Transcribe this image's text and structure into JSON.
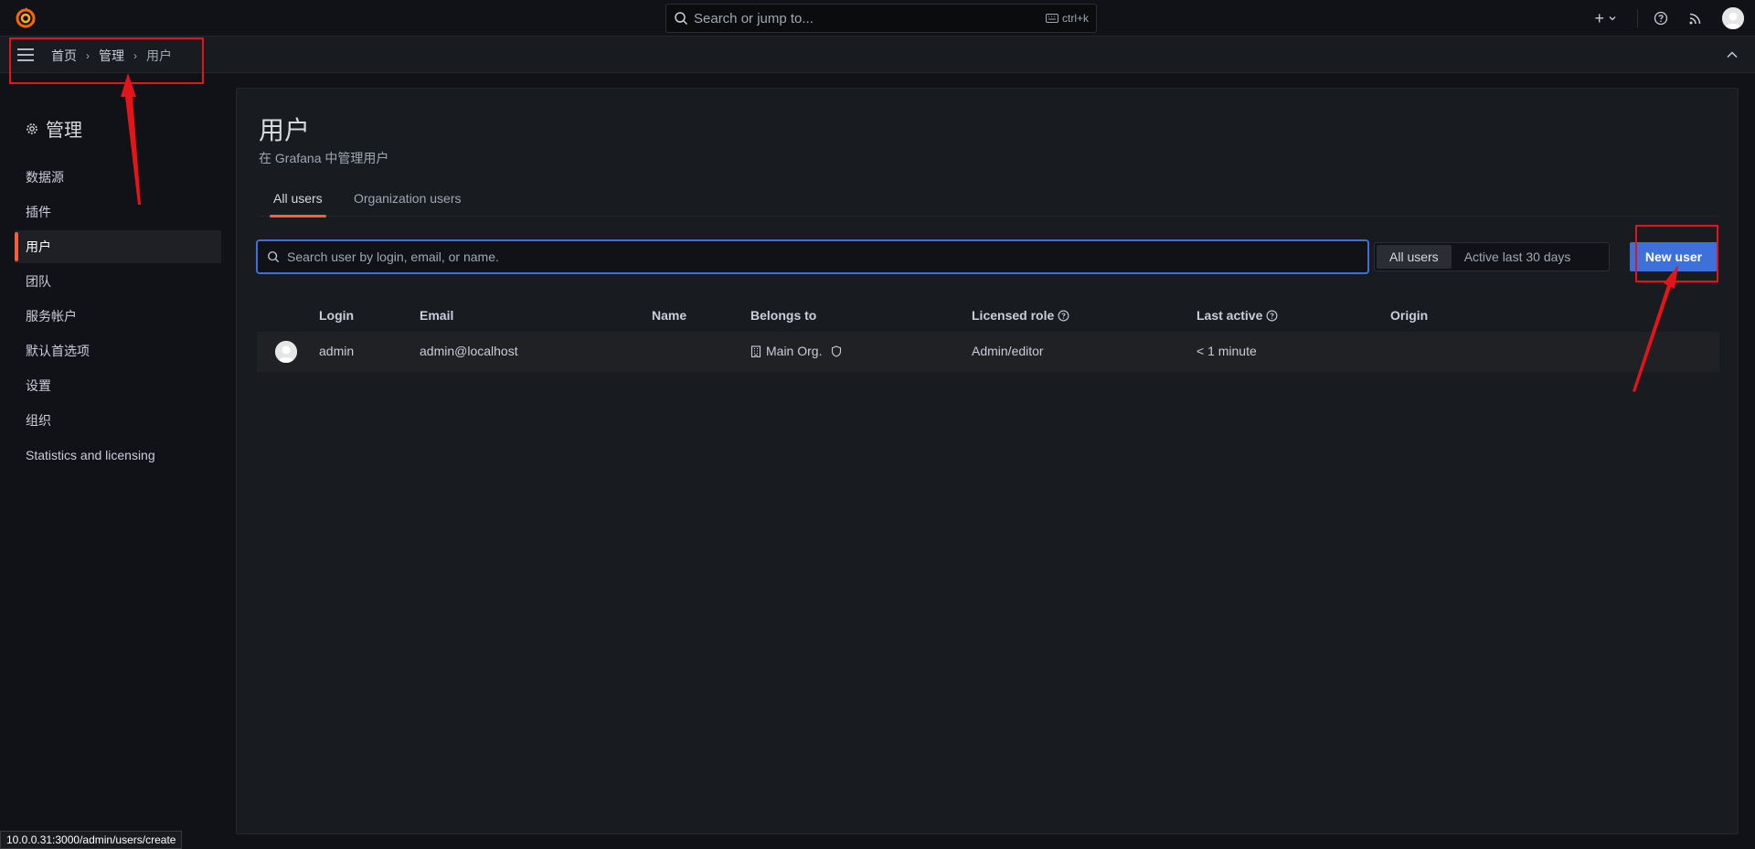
{
  "topbar": {
    "search_placeholder": "Search or jump to...",
    "search_shortcut": "ctrl+k",
    "add_label": "+"
  },
  "breadcrumb": {
    "home": "首页",
    "admin": "管理",
    "current": "用户"
  },
  "sidenav": {
    "title": "管理",
    "items": [
      {
        "label": "数据源",
        "active": false
      },
      {
        "label": "插件",
        "active": false
      },
      {
        "label": "用户",
        "active": true
      },
      {
        "label": "团队",
        "active": false
      },
      {
        "label": "服务帐户",
        "active": false
      },
      {
        "label": "默认首选项",
        "active": false
      },
      {
        "label": "设置",
        "active": false
      },
      {
        "label": "组织",
        "active": false
      },
      {
        "label": "Statistics and licensing",
        "active": false
      }
    ]
  },
  "page": {
    "title": "用户",
    "subtitle": "在 Grafana 中管理用户",
    "tabs": [
      {
        "label": "All users",
        "active": true
      },
      {
        "label": "Organization users",
        "active": false
      }
    ],
    "search_placeholder": "Search user by login, email, or name.",
    "filter_options": [
      {
        "label": "All users",
        "active": true
      },
      {
        "label": "Active last 30 days",
        "active": false
      }
    ],
    "new_user_label": "New user"
  },
  "table": {
    "headers": {
      "login": "Login",
      "email": "Email",
      "name": "Name",
      "belongs_to": "Belongs to",
      "licensed_role": "Licensed role",
      "last_active": "Last active",
      "origin": "Origin"
    },
    "rows": [
      {
        "login": "admin",
        "email": "admin@localhost",
        "name": "",
        "belongs_to": "Main Org.",
        "licensed_role": "Admin/editor",
        "last_active": "< 1 minute",
        "origin": ""
      }
    ]
  },
  "status_url": "10.0.0.31:3000/admin/users/create",
  "colors": {
    "accent": "#f55f3e",
    "primary": "#3d71d9",
    "annotation": "#e5141b",
    "background": "#111217",
    "panel": "#181b1f"
  }
}
